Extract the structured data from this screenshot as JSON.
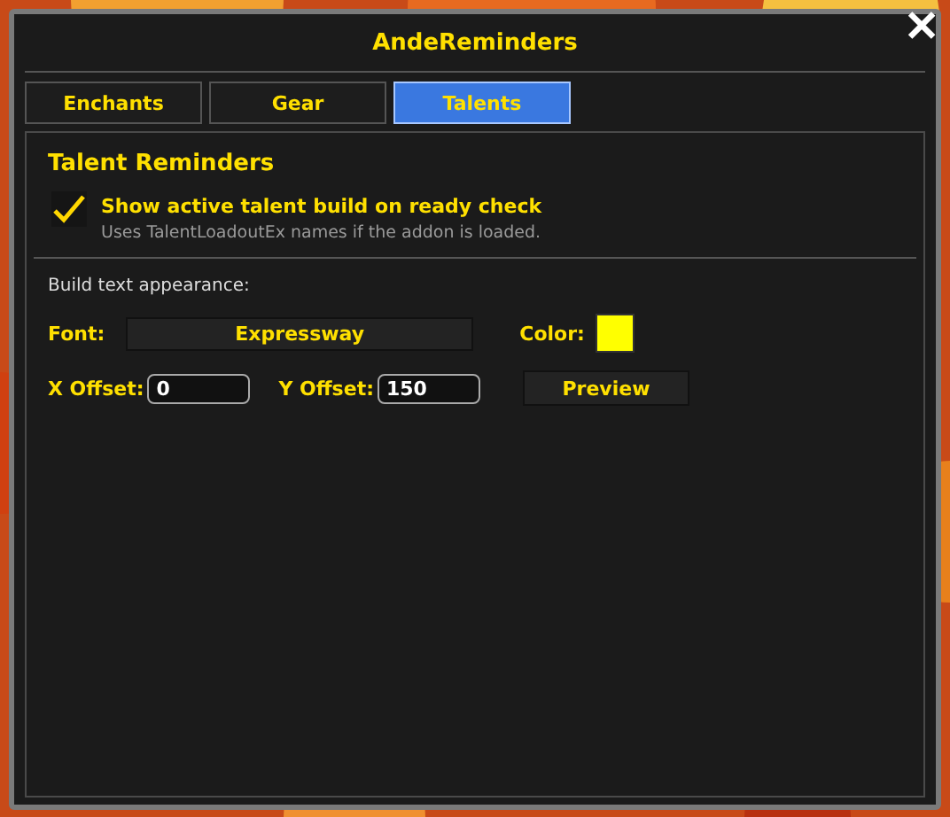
{
  "window": {
    "title": "AndeReminders",
    "close": "✕"
  },
  "tabs": [
    {
      "label": "Enchants",
      "selected": false
    },
    {
      "label": "Gear",
      "selected": false
    },
    {
      "label": "Talents",
      "selected": true
    }
  ],
  "section": {
    "title": "Talent Reminders"
  },
  "option": {
    "label": "Show active talent build on ready check",
    "hint": "Uses TalentLoadoutEx names if the addon is loaded.",
    "checked": true
  },
  "appearance": {
    "heading": "Build text appearance:",
    "font_label": "Font:",
    "font_value": "Expressway",
    "color_label": "Color:",
    "color": "#ffff00",
    "x_label": "X Offset:",
    "x_value": "0",
    "y_label": "Y Offset:",
    "y_value": "150",
    "preview": "Preview"
  }
}
